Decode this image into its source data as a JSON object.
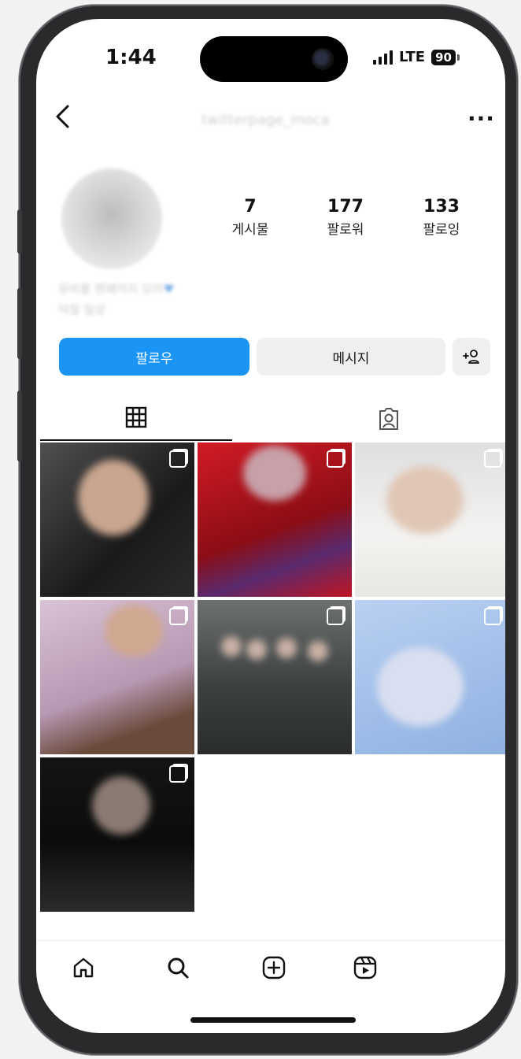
{
  "status_bar": {
    "time": "1:44",
    "network": "LTE",
    "battery": "90"
  },
  "header": {
    "username": "twitterpage_moca",
    "more_label": "···",
    "back_label": "<"
  },
  "profile": {
    "stats": [
      {
        "value": "7",
        "label": "게시물"
      },
      {
        "value": "177",
        "label": "팔로워"
      },
      {
        "value": "133",
        "label": "팔로잉"
      }
    ],
    "bio_line1": "뮤비촬 팬페이지 모아",
    "bio_heart": "♥",
    "bio_line2": "덕질 일상"
  },
  "actions": {
    "follow": "팔로우",
    "message": "메시지",
    "add_person": "+ዹ"
  },
  "tabs": [
    "grid-icon",
    "tagged-person-icon"
  ],
  "posts": [
    {
      "bg": "#2a2a2a"
    },
    {
      "bg": "#b5141e"
    },
    {
      "bg": "#e8e6e2"
    },
    {
      "bg": "#c8b2c8"
    },
    {
      "bg": "#4a4d4e"
    },
    {
      "bg": "#a9c6ec"
    },
    {
      "bg": "#111111"
    }
  ],
  "bottom_nav": [
    "home-icon",
    "search-icon",
    "create-icon",
    "reels-icon"
  ],
  "colors": {
    "accent": "#1b95f5",
    "button_gray": "#efefef"
  }
}
